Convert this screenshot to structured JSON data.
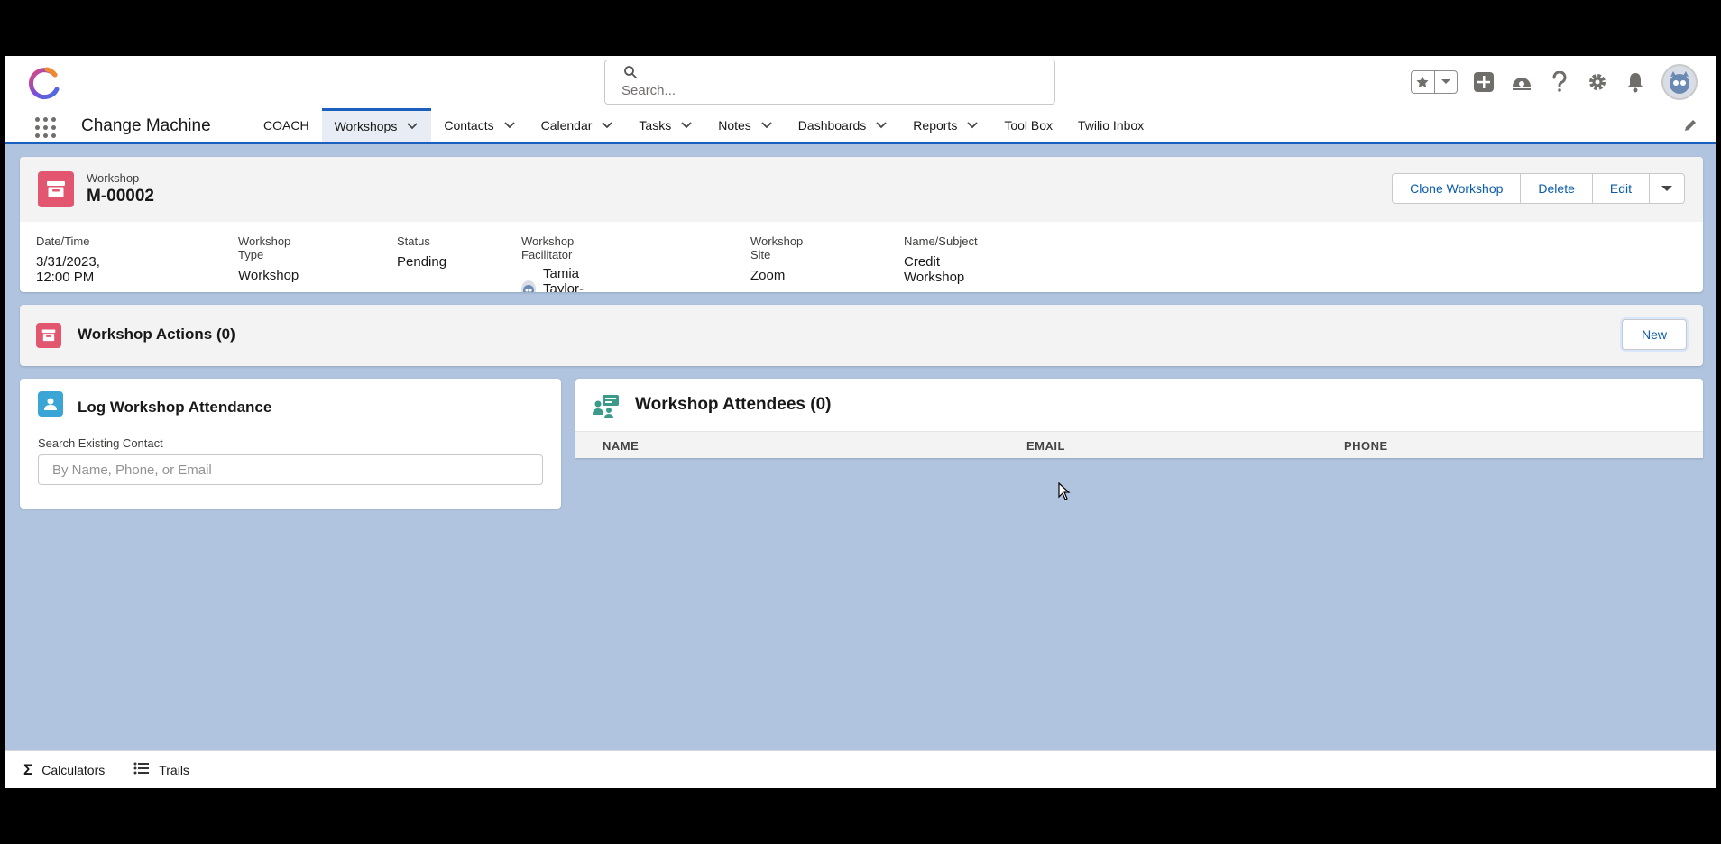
{
  "app": {
    "name": "Change Machine"
  },
  "search": {
    "placeholder": "Search..."
  },
  "nav": {
    "tabs": [
      {
        "label": "COACH",
        "has_menu": false,
        "active": false
      },
      {
        "label": "Workshops",
        "has_menu": true,
        "active": true
      },
      {
        "label": "Contacts",
        "has_menu": true,
        "active": false
      },
      {
        "label": "Calendar",
        "has_menu": true,
        "active": false
      },
      {
        "label": "Tasks",
        "has_menu": true,
        "active": false
      },
      {
        "label": "Notes",
        "has_menu": true,
        "active": false
      },
      {
        "label": "Dashboards",
        "has_menu": true,
        "active": false
      },
      {
        "label": "Reports",
        "has_menu": true,
        "active": false
      },
      {
        "label": "Tool Box",
        "has_menu": false,
        "active": false
      },
      {
        "label": "Twilio Inbox",
        "has_menu": false,
        "active": false
      }
    ]
  },
  "record": {
    "object_type": "Workshop",
    "name": "M-00002",
    "actions": {
      "clone": "Clone Workshop",
      "delete": "Delete",
      "edit": "Edit"
    },
    "fields": {
      "datetime": {
        "label": "Date/Time",
        "value": "3/31/2023, 12:00 PM"
      },
      "type": {
        "label": "Workshop Type",
        "value": "Workshop"
      },
      "status": {
        "label": "Status",
        "value": "Pending"
      },
      "facilitator": {
        "label": "Workshop Facilitator",
        "value": "Tamia Taylor-Bader"
      },
      "site": {
        "label": "Workshop Site",
        "value": "Zoom"
      },
      "subject": {
        "label": "Name/Subject",
        "value": "Credit Workshop"
      }
    }
  },
  "workshop_actions": {
    "title": "Workshop Actions (0)",
    "new_label": "New"
  },
  "log_attendance": {
    "title": "Log Workshop Attendance",
    "search_label": "Search Existing Contact",
    "search_placeholder": "By Name, Phone, or Email"
  },
  "attendees": {
    "title": "Workshop Attendees (0)",
    "columns": [
      "NAME",
      "EMAIL",
      "PHONE"
    ]
  },
  "utility_bar": {
    "calculators": "Calculators",
    "trails": "Trails"
  },
  "colors": {
    "brand_blue": "#1b5fbf",
    "link_blue": "#0b5cab",
    "workshop_icon": "#e3566f",
    "contact_icon": "#3ba6d5",
    "attendees_icon": "#3c9a8a",
    "page_bg": "#b0c4df"
  }
}
